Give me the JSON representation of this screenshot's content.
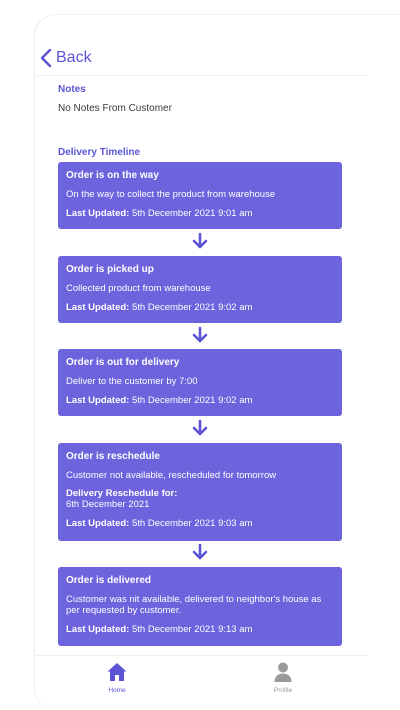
{
  "header": {
    "back_label": "Back"
  },
  "notes": {
    "title": "Notes",
    "text": "No Notes From Customer"
  },
  "timeline": {
    "title": "Delivery Timeline",
    "updated_label": "Last Updated:",
    "cards": [
      {
        "title": "Order is on the way",
        "description": "On the way to collect the product from warehouse",
        "updated": "5th December 2021 9:01 am"
      },
      {
        "title": "Order is picked up",
        "description": "Collected product from warehouse",
        "updated": "5th December 2021 9:02 am"
      },
      {
        "title": "Order is out for delivery",
        "description": "Deliver to the customer by 7:00",
        "updated": "5th December 2021 9:02 am"
      },
      {
        "title": "Order is reschedule",
        "description": "Customer not available, rescheduled for tomorrow",
        "reschedule_label": "Delivery Reschedule for:",
        "reschedule_date": "6th December 2021",
        "updated": "5th December 2021 9:03 am"
      },
      {
        "title": "Order is delivered",
        "description": "Customer was nit available, delivered to neighbor's house as per requested by customer.",
        "updated": "5th December 2021 9:13 am"
      }
    ]
  },
  "tabbar": {
    "home": {
      "label": "Home",
      "icon": "home-icon",
      "color": "#5b55d6"
    },
    "profile": {
      "label": "Profile",
      "icon": "person-icon",
      "color": "#9a9a9a"
    }
  },
  "colors": {
    "accent": "#5b55d6",
    "card": "#6c63dd"
  }
}
